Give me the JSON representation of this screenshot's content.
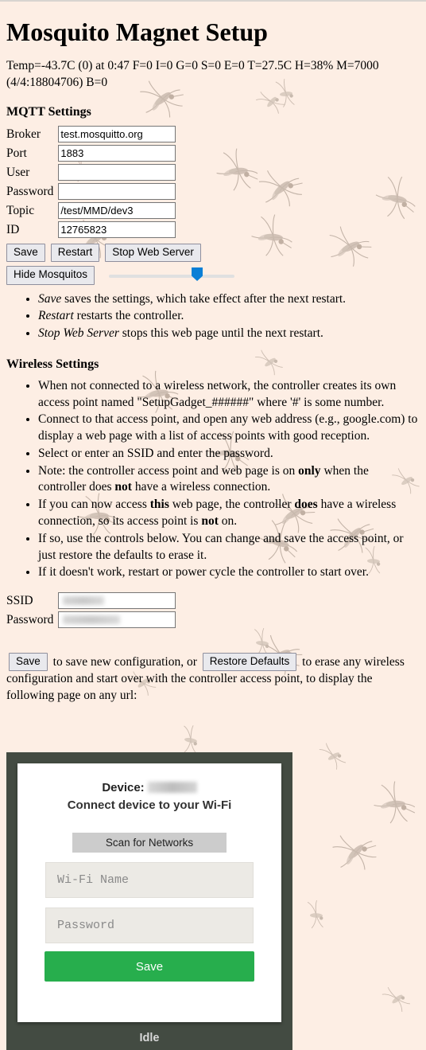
{
  "page": {
    "title": "Mosquito Magnet Setup",
    "status_line": "Temp=-43.7C (0) at 0:47 F=0 I=0 G=0 S=0 E=0 T=27.5C H=38% M=7000 (4/4:18804706) B=0"
  },
  "mqtt": {
    "heading": "MQTT Settings",
    "fields": [
      {
        "label": "Broker",
        "value": "test.mosquitto.org",
        "redacted": false
      },
      {
        "label": "Port",
        "value": "1883",
        "redacted": false
      },
      {
        "label": "User",
        "value": "",
        "redacted": false
      },
      {
        "label": "Password",
        "value": "",
        "redacted": false
      },
      {
        "label": "Topic",
        "value": "/test/MMD/dev3",
        "redacted": false
      },
      {
        "label": "ID",
        "value": "12765823",
        "redacted": false
      }
    ],
    "buttons": {
      "save": "Save",
      "restart": "Restart",
      "stop_web_server": "Stop Web Server",
      "hide_mosquitos": "Hide Mosquitos"
    },
    "slider": {
      "value": 72,
      "min": 0,
      "max": 100
    },
    "notes": [
      {
        "em": "Save",
        "rest": " saves the settings, which take effect after the next restart."
      },
      {
        "em": "Restart",
        "rest": " restarts the controller."
      },
      {
        "em": "Stop Web Server",
        "rest": " stops this web page until the next restart."
      }
    ]
  },
  "wireless": {
    "heading": "Wireless Settings",
    "notes": [
      "When not connected to a wireless network, the controller creates its own access point named \"SetupGadget_######\" where '#' is some number.",
      "Connect to that access point, and open any web address (e.g., google.com) to display a web page with a list of access points with good reception.",
      "Select or enter an SSID and enter the password.",
      "Note: the controller access point and web page is on <b>only</b> when the controller does <b>not</b> have a wireless connection.",
      "If you can now access <b>this</b> web page, the controller <b>does</b> have a wireless connection, so its access point is <b>not</b> on.",
      "If so, use the controls below. You can change and save the access point, or just restore the defaults to erase it.",
      "If it doesn't work, restart or power cycle the controller to start over."
    ],
    "fields": [
      {
        "label": "SSID",
        "value": "",
        "redacted": true,
        "redact_width": 52
      },
      {
        "label": "Password",
        "value": "",
        "redacted": true,
        "redact_width": 72
      }
    ],
    "save_label": "Save",
    "restore_label": "Restore Defaults",
    "sentence_mid": " to save new configuration, or ",
    "sentence_end": " to erase any wireless configuration and start over with the controller access point, to display the following page on any url:"
  },
  "phone": {
    "device_prefix": "Device:",
    "device_name": "",
    "title": "Connect device to your Wi-Fi",
    "scan_button": "Scan for Networks",
    "ssid_placeholder": "Wi-Fi Name",
    "password_placeholder": "Password",
    "save_button": "Save",
    "status": "Idle"
  },
  "colors": {
    "background": "#fdeee4",
    "phone_frame": "#434b42",
    "save_green": "#27ae4d",
    "slider_blue": "#0a7fd6",
    "button_face": "#e9e9ed"
  }
}
